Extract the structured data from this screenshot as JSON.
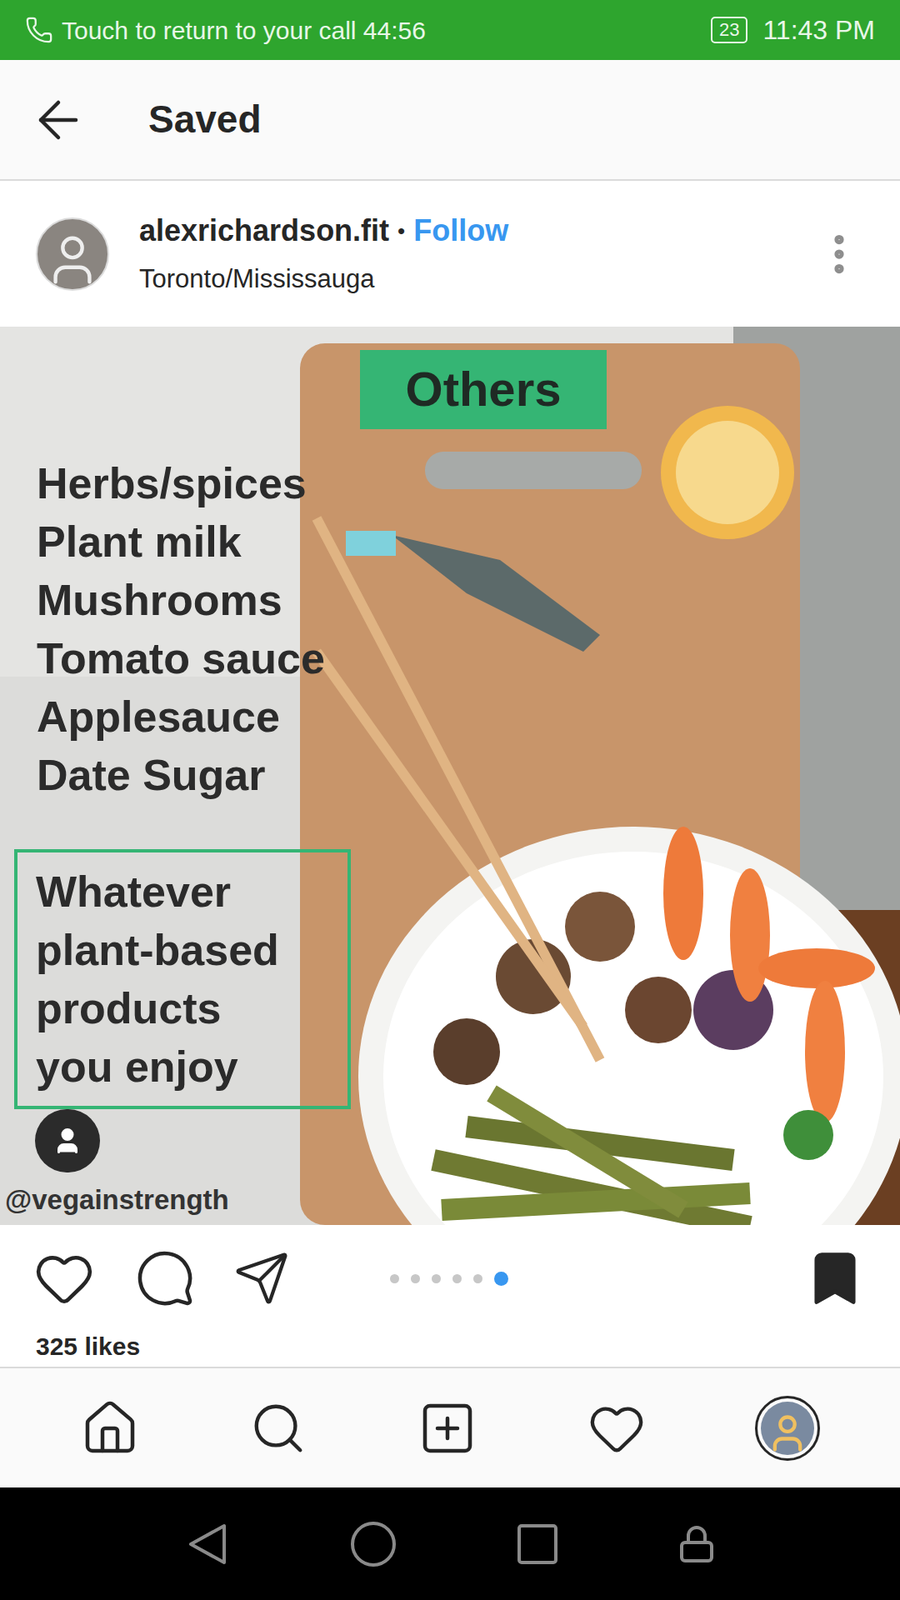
{
  "status_bar": {
    "call_banner": "Touch to return to your call",
    "call_time": "44:56",
    "battery": "23",
    "time": "11:43 PM"
  },
  "header": {
    "title": "Saved"
  },
  "post": {
    "username": "alexrichardson.fit",
    "separator": "•",
    "follow_label": "Follow",
    "location": "Toronto/Mississauga",
    "image": {
      "heading": "Others",
      "items": [
        "Herbs/spices",
        "Plant milk",
        "Mushrooms",
        "Tomato sauce",
        "Applesauce",
        "Date Sugar"
      ],
      "callout_lines": [
        "Whatever",
        "plant-based",
        "products",
        "you enjoy"
      ],
      "credit": "@vegainstrength"
    },
    "carousel": [
      {
        "selected": false
      },
      {
        "selected": false
      },
      {
        "selected": false
      },
      {
        "selected": false
      },
      {
        "selected": false
      },
      {
        "selected": true
      }
    ],
    "saved": true,
    "likes": "325 likes"
  }
}
